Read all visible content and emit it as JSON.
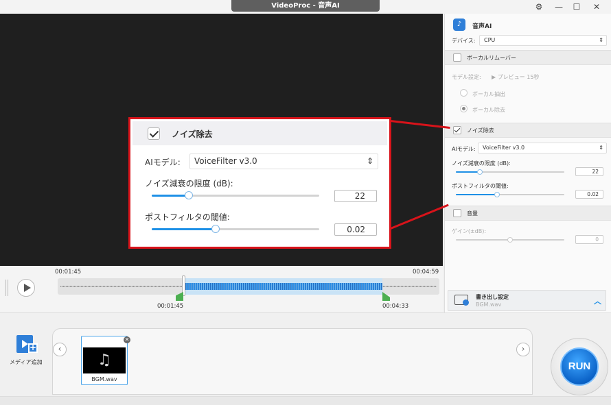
{
  "window": {
    "title": "VideoProc - 音声AI",
    "settings_icon": "gear-icon",
    "minimize": "—",
    "maximize": "☐",
    "close": "✕"
  },
  "timeline": {
    "time_start": "00:01:45",
    "time_end": "00:04:59",
    "marker_in": "00:01:45",
    "marker_out": "00:04:33",
    "play_icon": "play-icon"
  },
  "panel": {
    "title": "音声AI",
    "device_label": "デバイス:",
    "device_value": "CPU",
    "vocal_remover": {
      "label": "ボーカルリムーバー",
      "checked": false,
      "model_label": "モデル設定:",
      "preview_label": "プレビュー 15秒",
      "opt_extract": "ボーカル抽出",
      "opt_remove": "ボーカル除去"
    },
    "noise": {
      "label": "ノイズ除去",
      "checked": true,
      "model_label": "AIモデル:",
      "model_value": "VoiceFilter v3.0",
      "limit_label": "ノイズ減衰の限度 (dB):",
      "limit_value": "22",
      "limit_level": 0.22,
      "post_label": "ポストフィルタの閾値:",
      "post_value": "0.02",
      "post_level": 0.38
    },
    "volume": {
      "label": "音量",
      "checked": false,
      "gain_label": "ゲイン(±dB):",
      "gain_value": "0",
      "gain_level": 0.5
    },
    "export": {
      "label": "書き出し設定",
      "file": "BGM.wav"
    }
  },
  "zoom": {
    "label": "ノイズ除去",
    "model_label": "AIモデル:",
    "model_value": "VoiceFilter v3.0",
    "limit_label": "ノイズ減衰の限度 (dB):",
    "limit_value": "22",
    "post_label": "ポストフィルタの閾値:",
    "post_value": "0.02"
  },
  "bottom": {
    "add_media_label": "メディア追加",
    "clip_name": "BGM.wav",
    "run_label": "RUN"
  },
  "colors": {
    "accent": "#1e90e6",
    "callout": "#d8131a",
    "run": "#0b63c8",
    "marker": "#4caf50"
  }
}
